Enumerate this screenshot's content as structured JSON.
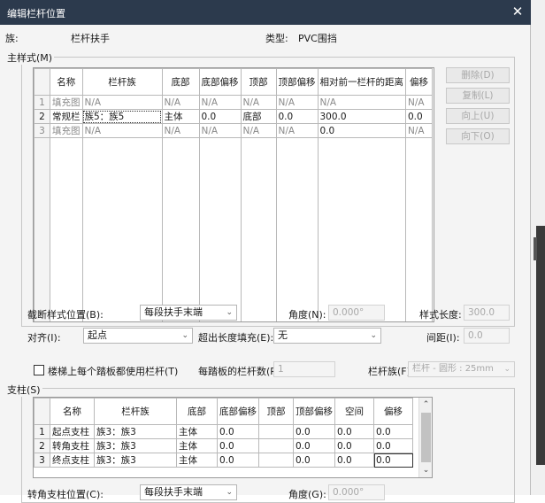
{
  "window": {
    "title": "编辑栏杆位置",
    "close_glyph": "✕"
  },
  "header": {
    "family_label": "族:",
    "family_value": "栏杆扶手",
    "type_label": "类型:",
    "type_value": "PVC围挡"
  },
  "main_pattern": {
    "title": "主样式(M)",
    "columns": [
      "名称",
      "栏杆族",
      "底部",
      "底部偏移",
      "顶部",
      "顶部偏移",
      "相对前一栏杆的距离",
      "偏移"
    ],
    "rows": [
      {
        "num": "1",
        "cells": [
          "填充图",
          "N/A",
          "N/A",
          "N/A",
          "N/A",
          "N/A",
          "N/A",
          "N/A"
        ]
      },
      {
        "num": "2",
        "cells": [
          "常规栏",
          "族5：族5",
          "主体",
          "0.0",
          "底部",
          "0.0",
          "300.0",
          "0.0"
        ]
      },
      {
        "num": "3",
        "cells": [
          "填充图",
          "N/A",
          "N/A",
          "N/A",
          "N/A",
          "N/A",
          "0.0",
          "N/A"
        ]
      }
    ],
    "buttons": {
      "delete": "删除(D)",
      "copy": "复制(L)",
      "up": "向上(U)",
      "down": "向下(O)"
    },
    "break_pattern_label": "截断样式位置(B):",
    "break_pattern_value": "每段扶手末端",
    "angle_label": "角度(N):",
    "angle_value": "0.000°",
    "pattern_length_label": "样式长度:",
    "pattern_length_value": "300.0",
    "justify_label": "对齐(I):",
    "justify_value": "起点",
    "excess_fill_label": "超出长度填充(E):",
    "excess_fill_value": "无",
    "spacing_label": "间距(I):",
    "spacing_value": "0.0"
  },
  "stair_options": {
    "per_tread_label": "楼梯上每个踏板都使用栏杆(T)",
    "per_tread_checked": false,
    "balusters_per_tread_label": "每踏板的栏杆数(R):",
    "balusters_per_tread_value": "1",
    "baluster_family_label": "栏杆族(F):",
    "baluster_family_value": "栏杆 - 圆形 : 25mm"
  },
  "posts": {
    "title": "支柱(S)",
    "columns": [
      "名称",
      "栏杆族",
      "底部",
      "底部偏移",
      "顶部",
      "顶部偏移",
      "空间",
      "偏移"
    ],
    "rows": [
      {
        "num": "1",
        "cells": [
          "起点支柱",
          "族3：族3",
          "主体",
          "0.0",
          "",
          "0.0",
          "0.0",
          "0.0"
        ]
      },
      {
        "num": "2",
        "cells": [
          "转角支柱",
          "族3：族3",
          "主体",
          "0.0",
          "",
          "0.0",
          "0.0",
          "0.0"
        ]
      },
      {
        "num": "3",
        "cells": [
          "终点支柱",
          "族3：族3",
          "主体",
          "0.0",
          "",
          "0.0",
          "0.0",
          "0.0"
        ]
      }
    ],
    "corner_post_label": "转角支柱位置(C):",
    "corner_post_value": "每段扶手末端",
    "corner_angle_label": "角度(G):",
    "corner_angle_value": "0.000°"
  },
  "glyphs": {
    "chevron_down": "⌄",
    "scroll_up": "⌃",
    "scroll_down": "⌄"
  }
}
